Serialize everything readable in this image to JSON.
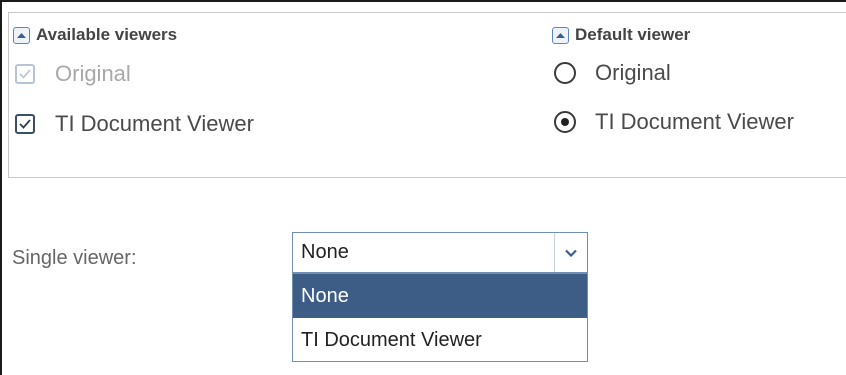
{
  "available_viewers": {
    "title": "Available viewers",
    "options": [
      {
        "label": "Original",
        "checked": true,
        "disabled": true
      },
      {
        "label": "TI Document Viewer",
        "checked": true,
        "disabled": false
      }
    ]
  },
  "default_viewer": {
    "title": "Default viewer",
    "options": [
      {
        "label": "Original",
        "selected": false
      },
      {
        "label": "TI Document Viewer",
        "selected": true
      }
    ]
  },
  "single_viewer": {
    "label": "Single viewer:",
    "value": "None",
    "options": [
      "None",
      "TI Document Viewer"
    ],
    "highlighted": "None"
  },
  "colors": {
    "highlight": "#3d5d86",
    "border": "#6f8fb3",
    "disabled_text": "#a8a8a8"
  }
}
